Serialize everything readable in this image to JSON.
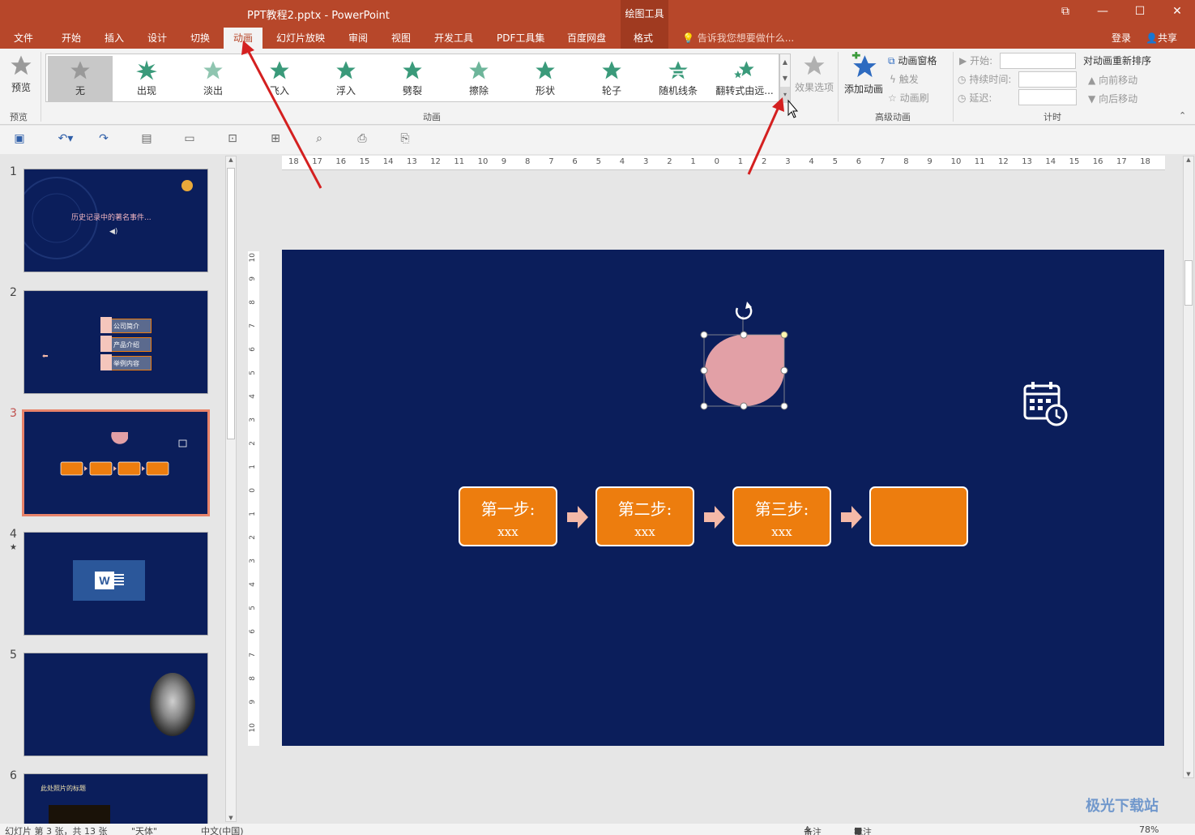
{
  "window": {
    "title": "PPT教程2.pptx - PowerPoint",
    "context_tool": "绘图工具",
    "controls": {
      "ribbon_display": "⧉",
      "minimize": "—",
      "maximize": "☐",
      "close": "✕"
    }
  },
  "tabs": [
    {
      "label": "文件"
    },
    {
      "label": "开始"
    },
    {
      "label": "插入"
    },
    {
      "label": "设计"
    },
    {
      "label": "切换"
    },
    {
      "label": "动画",
      "active": true
    },
    {
      "label": "幻灯片放映"
    },
    {
      "label": "审阅"
    },
    {
      "label": "视图"
    },
    {
      "label": "开发工具"
    },
    {
      "label": "PDF工具集"
    },
    {
      "label": "百度网盘"
    },
    {
      "label": "格式"
    }
  ],
  "tell_me": "告诉我您想要做什么...",
  "signin": "登录",
  "share": "共享",
  "ribbon": {
    "preview": {
      "label": "预览",
      "group": "预览"
    },
    "animations": {
      "group": "动画",
      "items": [
        "无",
        "出现",
        "淡出",
        "飞入",
        "浮入",
        "劈裂",
        "擦除",
        "形状",
        "轮子",
        "随机线条",
        "翻转式由远..."
      ]
    },
    "effect_options": "效果选项",
    "advanced": {
      "group": "高级动画",
      "add_animation": "添加动画",
      "animation_pane": "动画窗格",
      "trigger": "触发",
      "animation_painter": "动画刷"
    },
    "timing": {
      "group": "计时",
      "start": "开始:",
      "duration": "持续时间:",
      "delay": "延迟:",
      "reorder": "对动画重新排序",
      "move_earlier": "向前移动",
      "move_later": "向后移动"
    }
  },
  "thumbnails": [
    {
      "num": "1",
      "text": "历史记录中的著名事件..."
    },
    {
      "num": "2",
      "items": [
        "公司简介",
        "产品介绍",
        "举例内容"
      ]
    },
    {
      "num": "3",
      "active": true
    },
    {
      "num": "4",
      "star": "★"
    },
    {
      "num": "5"
    },
    {
      "num": "6",
      "text": "此处照片的标题"
    }
  ],
  "ruler": {
    "h": [
      "18",
      "17",
      "16",
      "15",
      "14",
      "13",
      "12",
      "11",
      "10",
      "9",
      "8",
      "7",
      "6",
      "5",
      "4",
      "3",
      "2",
      "1",
      "0",
      "1",
      "2",
      "3",
      "4",
      "5",
      "6",
      "7",
      "8",
      "9",
      "10",
      "11",
      "12",
      "13",
      "14",
      "15",
      "16",
      "17",
      "18"
    ],
    "v": [
      "10",
      "9",
      "8",
      "7",
      "6",
      "5",
      "4",
      "3",
      "2",
      "1",
      "0",
      "1",
      "2",
      "3",
      "4",
      "5",
      "6",
      "7",
      "8",
      "9",
      "10"
    ]
  },
  "slide": {
    "steps": [
      {
        "title": "第一步:",
        "sub": "xxx"
      },
      {
        "title": "第二步:",
        "sub": "xxx"
      },
      {
        "title": "第三步:",
        "sub": "xxx"
      },
      {
        "title": "",
        "sub": ""
      }
    ],
    "colors": {
      "background": "#0b1e5b",
      "step": "#ed7d0e",
      "shape": "#e2a0a6",
      "arrow": "#f4b9a8"
    }
  },
  "statusbar": {
    "slide_info": "幻灯片 第 3 张，共 13 张",
    "theme": "\"天体\"",
    "language": "中文(中国)",
    "notes": "备注",
    "comments": "批注",
    "zoom": "78%"
  },
  "watermark": "极光下载站"
}
